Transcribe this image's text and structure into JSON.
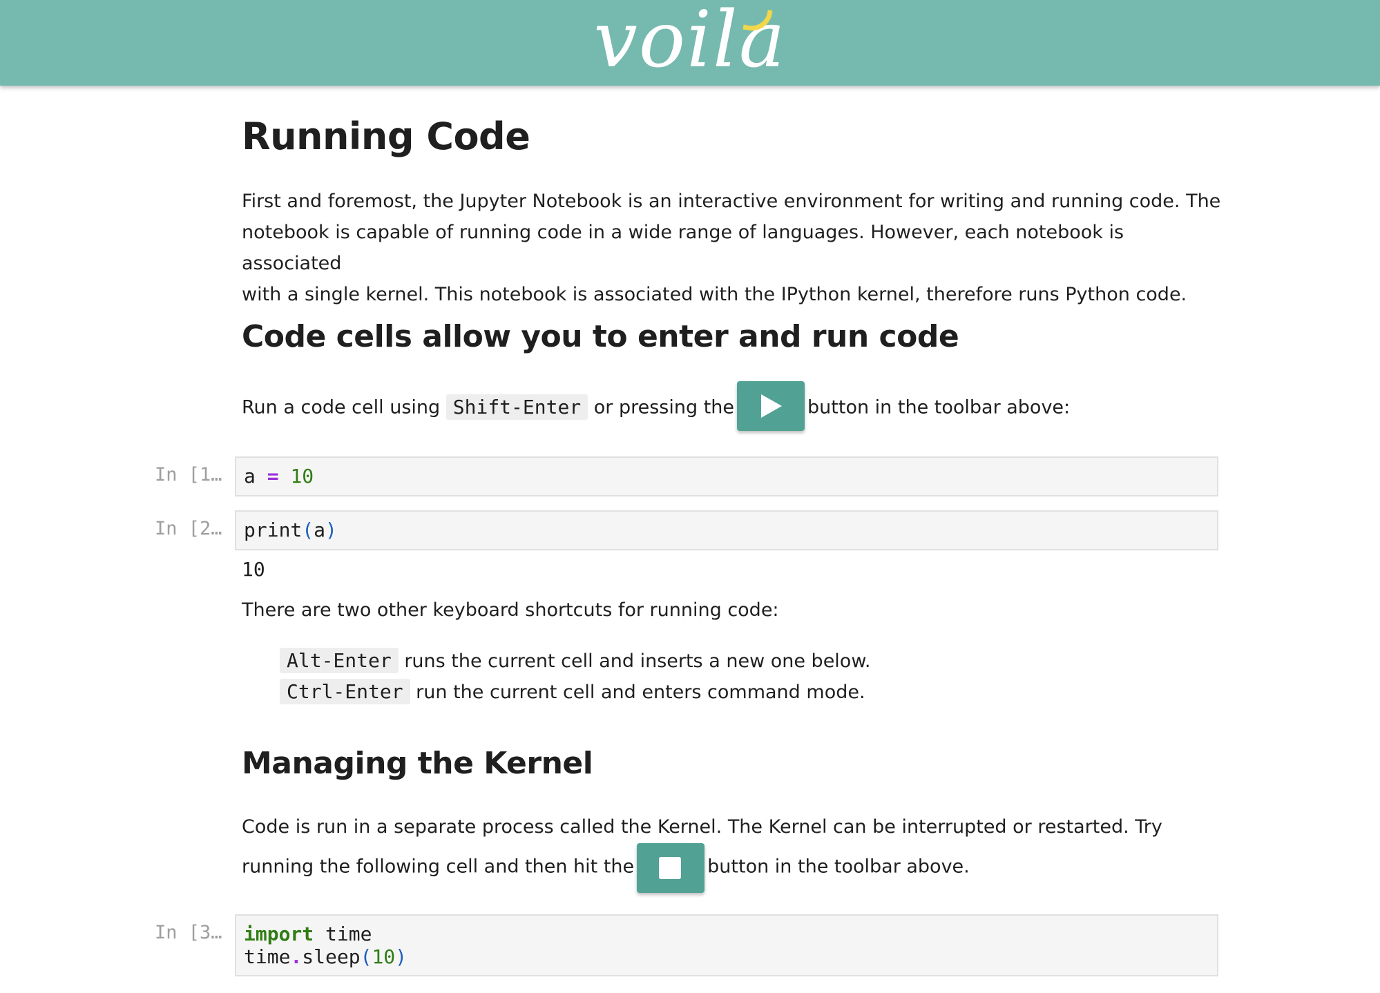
{
  "header": {
    "logo_text": "voila"
  },
  "running_code": {
    "title": "Running Code",
    "intro_line1": "First and foremost, the Jupyter Notebook is an interactive environment for writing and running code. The",
    "intro_line2": "notebook is capable of running code in a wide range of languages. However, each notebook is associated",
    "intro_line3": "with a single kernel. This notebook is associated with the IPython kernel, therefore runs Python code."
  },
  "code_cells": {
    "title": "Code cells allow you to enter and run code",
    "run_text_before": "Run a code cell using",
    "run_shortcut": "Shift-Enter",
    "run_text_middle": "or pressing the",
    "run_text_after": "button in the toolbar above:"
  },
  "cells": [
    {
      "prompt": "In [1…",
      "code_a": "a",
      "code_eq": "=",
      "code_num": "10"
    },
    {
      "prompt": "In [2…",
      "code_fn": "print",
      "code_open": "(",
      "code_arg": "a",
      "code_close": ")",
      "output": "10"
    },
    {
      "prompt": "In [3…",
      "code_import": "import",
      "code_module": "time",
      "code_obj": "time",
      "code_dot": ".",
      "code_fn": "sleep",
      "code_open": "(",
      "code_arg": "10",
      "code_close": ")"
    }
  ],
  "shortcuts": {
    "intro": "There are two other keyboard shortcuts for running code:",
    "items": [
      {
        "key": "Alt-Enter",
        "desc": "runs the current cell and inserts a new one below."
      },
      {
        "key": "Ctrl-Enter",
        "desc": "run the current cell and enters command mode."
      }
    ]
  },
  "kernel": {
    "title": "Managing the Kernel",
    "line1": "Code is run in a separate process called the Kernel. The Kernel can be interrupted or restarted. Try",
    "line2_before": "running the following cell and then hit the",
    "line2_after": "button in the toolbar above."
  },
  "colors": {
    "header_bg": "#76b9ae",
    "toolbar_button": "#52a195",
    "logo_accent": "#f2d64b"
  }
}
